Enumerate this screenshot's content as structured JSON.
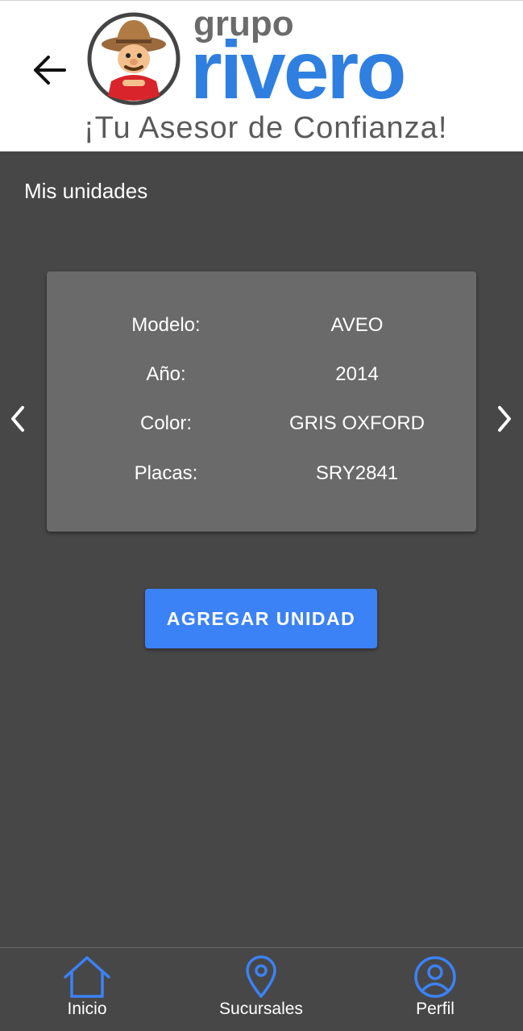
{
  "header": {
    "brand_small": "grupo",
    "brand_big": "rivero",
    "tagline": "¡Tu Asesor de Confianza!",
    "brand_color": "#2f7fe0"
  },
  "page_title": "Mis unidades",
  "vehicle_card": {
    "rows": [
      {
        "label": "Modelo:",
        "value": "AVEO"
      },
      {
        "label": "Año:",
        "value": "2014"
      },
      {
        "label": "Color:",
        "value": "GRIS OXFORD"
      },
      {
        "label": "Placas:",
        "value": "SRY2841"
      }
    ]
  },
  "add_button_label": "AGREGAR UNIDAD",
  "colors": {
    "background": "#474747",
    "card": "#6a6a6a",
    "accent": "#3b82f6"
  },
  "bottom_nav": {
    "items": [
      {
        "label": "Inicio",
        "icon": "home-icon"
      },
      {
        "label": "Sucursales",
        "icon": "location-pin-icon"
      },
      {
        "label": "Perfil",
        "icon": "user-circle-icon"
      }
    ]
  }
}
